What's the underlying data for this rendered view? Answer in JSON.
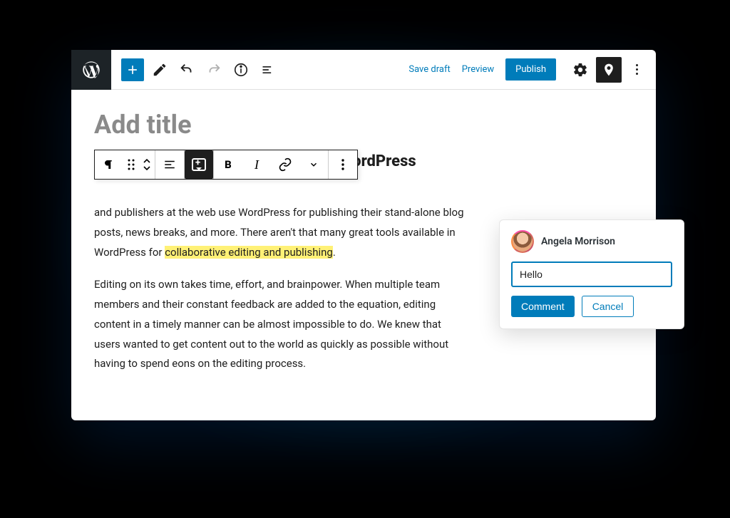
{
  "topbar": {
    "save_draft": "Save draft",
    "preview": "Preview",
    "publish": "Publish"
  },
  "editor": {
    "title_placeholder": "Add title",
    "heading": "Brings collaborative editing inside WordPress",
    "para1_before": "and publishers at the web use WordPress for publishing their stand-alone blog posts, news breaks, and more. There aren't that many great tools available in WordPress for ",
    "para1_highlight": "collaborative editing and publishing",
    "para1_after": ".",
    "para2": "Editing on its own takes time, effort, and brainpower. When multiple team members and their constant feedback are added to the equation, editing content in a timely manner can be almost impossible to do. We knew that users wanted to get content out to the world as quickly as possible without having to spend eons on the editing process."
  },
  "block_toolbar": {
    "bold": "B",
    "italic": "I"
  },
  "comment": {
    "author": "Angela Morrison",
    "input_value": "Hello",
    "submit": "Comment",
    "cancel": "Cancel"
  }
}
